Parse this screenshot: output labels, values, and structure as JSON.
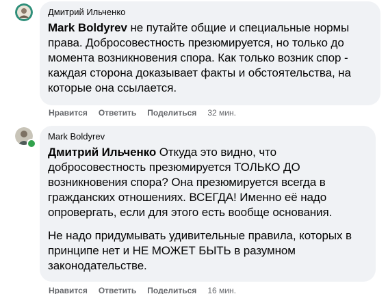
{
  "comments": [
    {
      "author": "Дмитрий Ильченко",
      "mention": "Mark Boldyrev",
      "paragraphs": [
        " не путайте общие и специальные нормы права. Добросовестность презюмируется, но только до момента возникновения спора. Как только возник спор - каждая сторона доказывает факты и обстоятельства, на которые она ссылается."
      ],
      "actions": {
        "like": "Нравится",
        "reply": "Ответить",
        "share": "Поделиться",
        "time": "32 мин."
      }
    },
    {
      "author": "Mark Boldyrev",
      "mention": "Дмитрий Ильченко",
      "paragraphs": [
        " Откуда это видно, что добросовестность презюмируется ТОЛЬКО ДО возникновения спора? Она презюмируется всегда в гражданских отношениях. ВСЕГДА! Именно её надо опровергать, если для этого есть вообще основания.",
        "Не надо придумывать удивительные правила, которых в принципе нет и НЕ МОЖЕТ БЫТЬ в разумном законодательстве."
      ],
      "actions": {
        "like": "Нравится",
        "reply": "Ответить",
        "share": "Поделиться",
        "time": "16 мин."
      },
      "online": true
    }
  ],
  "colors": {
    "bubble_bg": "#f0f2f5",
    "text": "#050505",
    "secondary": "#65676b",
    "online": "#31a24c"
  }
}
